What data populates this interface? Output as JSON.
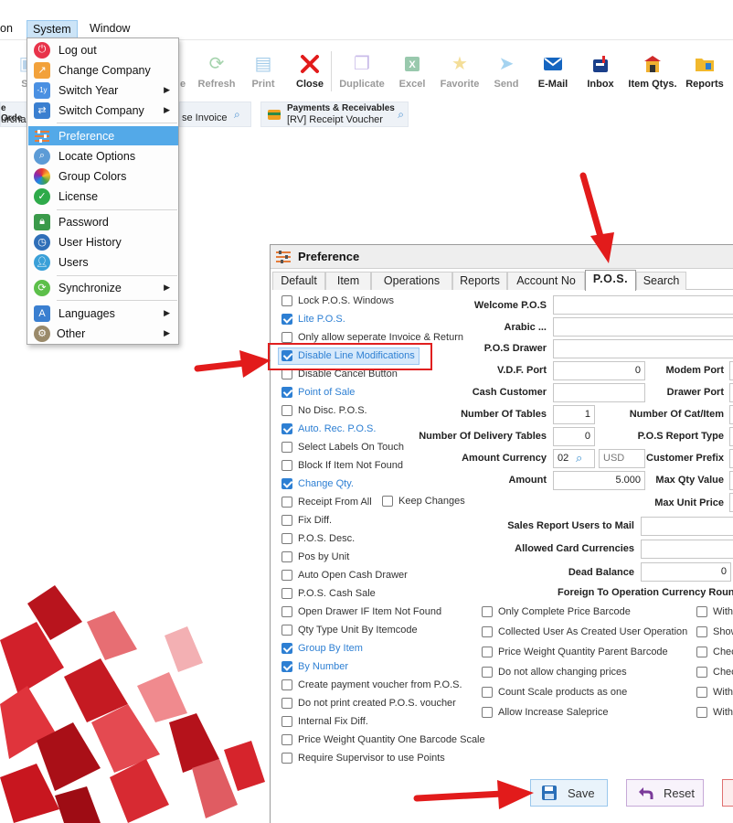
{
  "menubar": {
    "items": [
      "on",
      "System",
      "Window"
    ]
  },
  "toolbar": {
    "partial_left": "Se",
    "partial_hidden": "e",
    "buttons": [
      {
        "label": "Refresh",
        "icon": "refresh-icon",
        "disabled": true
      },
      {
        "label": "Print",
        "icon": "print-icon",
        "disabled": true
      },
      {
        "label": "Close",
        "icon": "close-icon",
        "disabled": false
      },
      {
        "label": "Duplicate",
        "icon": "duplicate-icon",
        "disabled": true
      },
      {
        "label": "Excel",
        "icon": "excel-icon",
        "disabled": true
      },
      {
        "label": "Favorite",
        "icon": "star-icon",
        "disabled": true
      },
      {
        "label": "Send",
        "icon": "send-icon",
        "disabled": true
      },
      {
        "label": "E-Mail",
        "icon": "email-icon",
        "disabled": false
      },
      {
        "label": "Inbox",
        "icon": "inbox-icon",
        "disabled": false
      },
      {
        "label": "Item Qtys.",
        "icon": "store-icon",
        "disabled": false
      },
      {
        "label": "Reports",
        "icon": "folder-icon",
        "disabled": false
      }
    ]
  },
  "shortcuts": {
    "left_line1": "e Orde",
    "left_line2": "urchas",
    "middle": "se Invoice",
    "right_title": "Payments & Receivables",
    "right_sub": "[RV] Receipt Voucher"
  },
  "system_menu": {
    "items": [
      {
        "label": "Log out",
        "icon": "power-icon",
        "submenu": false
      },
      {
        "label": "Change Company",
        "icon": "arrow-out-icon",
        "submenu": false
      },
      {
        "label": "Switch Year",
        "icon": "calendar-icon",
        "submenu": true
      },
      {
        "label": "Switch Company",
        "icon": "switch-icon",
        "submenu": true
      },
      {
        "label": "Preference",
        "icon": "sliders-icon",
        "submenu": false,
        "highlighted": true
      },
      {
        "label": "Locate Options",
        "icon": "magnifier-icon",
        "submenu": false
      },
      {
        "label": "Group Colors",
        "icon": "palette-icon",
        "submenu": false
      },
      {
        "label": "License",
        "icon": "check-badge-icon",
        "submenu": false
      },
      {
        "label": "Password",
        "icon": "lock-icon",
        "submenu": false
      },
      {
        "label": "User History",
        "icon": "clock-icon",
        "submenu": false
      },
      {
        "label": "Users",
        "icon": "user-icon",
        "submenu": false
      },
      {
        "label": "Synchronize",
        "icon": "sync-icon",
        "submenu": true
      },
      {
        "label": "Languages",
        "icon": "language-icon",
        "submenu": true
      },
      {
        "label": "Other",
        "icon": "gears-icon",
        "submenu": true
      }
    ]
  },
  "dialog": {
    "title": "Preference",
    "tabs": [
      "Default",
      "Item",
      "Operations",
      "Reports",
      "Account No",
      "P.O.S.",
      "Search"
    ],
    "active_tab": "P.O.S.",
    "left_checks": [
      {
        "label": "Lock P.O.S. Windows",
        "checked": false
      },
      {
        "label": "Lite P.O.S.",
        "checked": true
      },
      {
        "label": "Only allow seperate Invoice & Return",
        "checked": false
      },
      {
        "label": "Disable Line Modifications",
        "checked": true
      },
      {
        "label": "Disable Cancel Button",
        "checked": false
      },
      {
        "label": "Point of Sale",
        "checked": true
      },
      {
        "label": "No Disc. P.O.S.",
        "checked": false
      },
      {
        "label": "Auto. Rec. P.O.S.",
        "checked": true
      },
      {
        "label": "Select Labels On Touch",
        "checked": false
      },
      {
        "label": "Block If Item Not Found",
        "checked": false
      },
      {
        "label": "Change Qty.",
        "checked": true
      },
      {
        "label": "Receipt From All",
        "checked": false
      },
      {
        "label": "Fix Diff.",
        "checked": false
      },
      {
        "label": "P.O.S. Desc.",
        "checked": false
      },
      {
        "label": "Pos by Unit",
        "checked": false
      },
      {
        "label": "Auto Open Cash Drawer",
        "checked": false
      },
      {
        "label": "P.O.S. Cash Sale",
        "checked": false
      },
      {
        "label": "Open Drawer IF Item Not Found",
        "checked": false
      },
      {
        "label": "Qty Type Unit By Itemcode",
        "checked": false
      },
      {
        "label": "Group By Item",
        "checked": true
      },
      {
        "label": "By Number",
        "checked": true
      },
      {
        "label": "Create payment voucher from P.O.S.",
        "checked": false
      },
      {
        "label": "Do not print created P.O.S. voucher",
        "checked": false
      },
      {
        "label": "Internal Fix Diff.",
        "checked": false
      },
      {
        "label": "Price Weight Quantity One Barcode Scale",
        "checked": false
      },
      {
        "label": "Require Supervisor to use Points",
        "checked": false
      }
    ],
    "keep_changes": {
      "label": "Keep Changes",
      "checked": false
    },
    "fields": {
      "welcome_pos": {
        "label": "Welcome P.O.S",
        "value": ""
      },
      "arabic": {
        "label": "Arabic ...",
        "value": ""
      },
      "pos_drawer": {
        "label": "P.O.S Drawer",
        "value": ""
      },
      "vdf_port": {
        "label": "V.D.F. Port",
        "value": "0"
      },
      "cash_customer": {
        "label": "Cash Customer",
        "value": ""
      },
      "number_of_tables": {
        "label": "Number Of Tables",
        "value": "1"
      },
      "delivery_tables": {
        "label": "Number Of Delivery Tables",
        "value": "0"
      },
      "amount_currency": {
        "label": "Amount Currency",
        "code": "02",
        "currency": "USD"
      },
      "amount": {
        "label": "Amount",
        "value": "5.000"
      },
      "modem_port": {
        "label": "Modem Port"
      },
      "drawer_port": {
        "label": "Drawer Port"
      },
      "cat_item": {
        "label": "Number Of Cat/Item"
      },
      "report_type": {
        "label": "P.O.S Report Type"
      },
      "customer_prefix": {
        "label": "Customer Prefix"
      },
      "max_qty_value": {
        "label": "Max Qty Value"
      },
      "max_unit_price": {
        "label": "Max Unit Price"
      },
      "sales_report_users": {
        "label": "Sales Report Users to Mail",
        "value": ""
      },
      "allowed_card_currencies": {
        "label": "Allowed Card Currencies",
        "value": ""
      },
      "dead_balance": {
        "label": "Dead Balance",
        "value": "0"
      },
      "foreign_rounding": {
        "label": "Foreign To Operation Currency Roun"
      }
    },
    "middle_checks": [
      {
        "label": "Only Complete Price Barcode",
        "checked": false
      },
      {
        "label": "Collected User As Created User Operation",
        "checked": false
      },
      {
        "label": "Price Weight Quantity Parent Barcode",
        "checked": false
      },
      {
        "label": "Do not allow changing prices",
        "checked": false
      },
      {
        "label": "Count Scale products as one",
        "checked": false
      },
      {
        "label": "Allow Increase Saleprice",
        "checked": false
      }
    ],
    "right_checks": [
      {
        "label": "With",
        "checked": false
      },
      {
        "label": "Show",
        "checked": false
      },
      {
        "label": "Chec",
        "checked": false
      },
      {
        "label": "Chec",
        "checked": false
      },
      {
        "label": "With",
        "checked": false
      },
      {
        "label": "With",
        "checked": false
      }
    ],
    "buttons": {
      "save": "Save",
      "reset": "Reset"
    }
  },
  "colors": {
    "accent_blue": "#2d7fd3",
    "menu_highlight": "#53a9e8",
    "annotation_red": "#e01f1f"
  }
}
